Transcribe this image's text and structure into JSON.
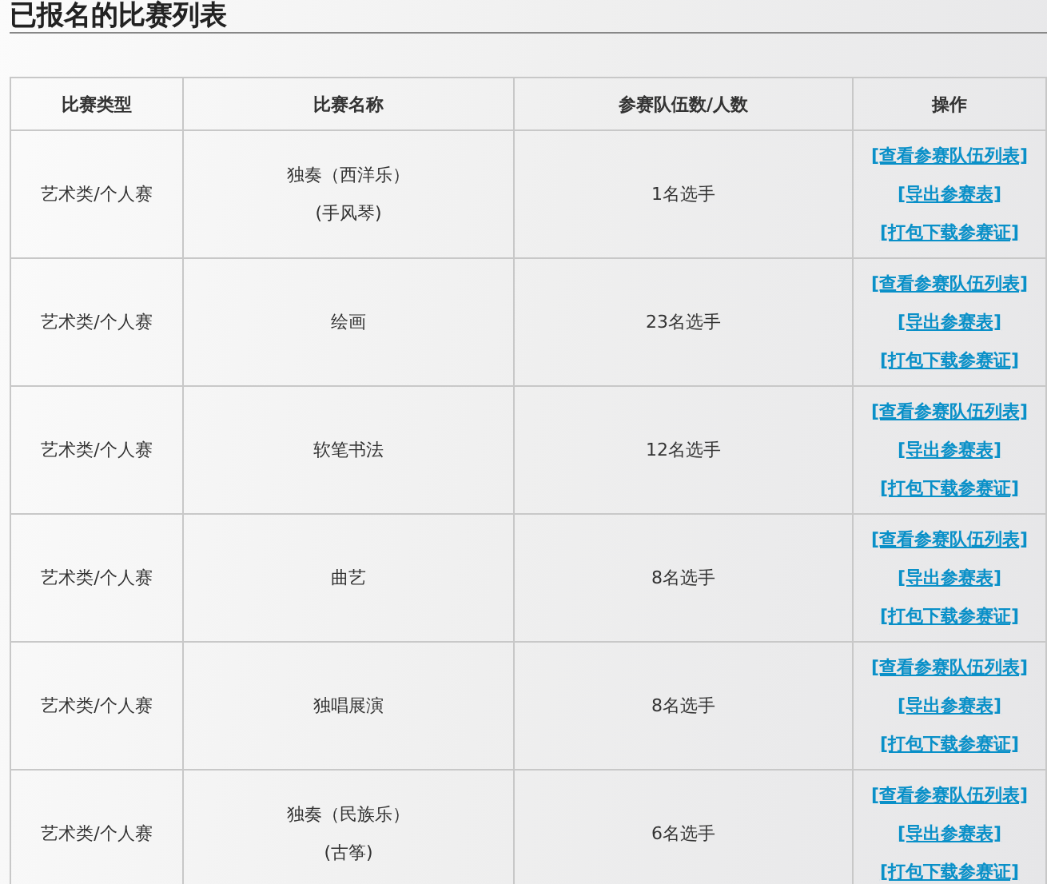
{
  "heading": "已报名的比赛列表",
  "table": {
    "columns": [
      "比赛类型",
      "比赛名称",
      "参赛队伍数/人数",
      "操作"
    ],
    "rows": [
      {
        "type": "艺术类/个人赛",
        "name": [
          "独奏（西洋乐）",
          "(手风琴)"
        ],
        "count": "1名选手",
        "actions": [
          "[查看参赛队伍列表]",
          "[导出参赛表]",
          "[打包下载参赛证]"
        ]
      },
      {
        "type": "艺术类/个人赛",
        "name": [
          "绘画"
        ],
        "count": "23名选手",
        "actions": [
          "[查看参赛队伍列表]",
          "[导出参赛表]",
          "[打包下载参赛证]"
        ]
      },
      {
        "type": "艺术类/个人赛",
        "name": [
          "软笔书法"
        ],
        "count": "12名选手",
        "actions": [
          "[查看参赛队伍列表]",
          "[导出参赛表]",
          "[打包下载参赛证]"
        ]
      },
      {
        "type": "艺术类/个人赛",
        "name": [
          "曲艺"
        ],
        "count": "8名选手",
        "actions": [
          "[查看参赛队伍列表]",
          "[导出参赛表]",
          "[打包下载参赛证]"
        ]
      },
      {
        "type": "艺术类/个人赛",
        "name": [
          "独唱展演"
        ],
        "count": "8名选手",
        "actions": [
          "[查看参赛队伍列表]",
          "[导出参赛表]",
          "[打包下载参赛证]"
        ]
      },
      {
        "type": "艺术类/个人赛",
        "name": [
          "独奏（民族乐）",
          "(古筝)"
        ],
        "count": "6名选手",
        "actions": [
          "[查看参赛队伍列表]",
          "[导出参赛表]",
          "[打包下载参赛证]"
        ]
      }
    ]
  }
}
